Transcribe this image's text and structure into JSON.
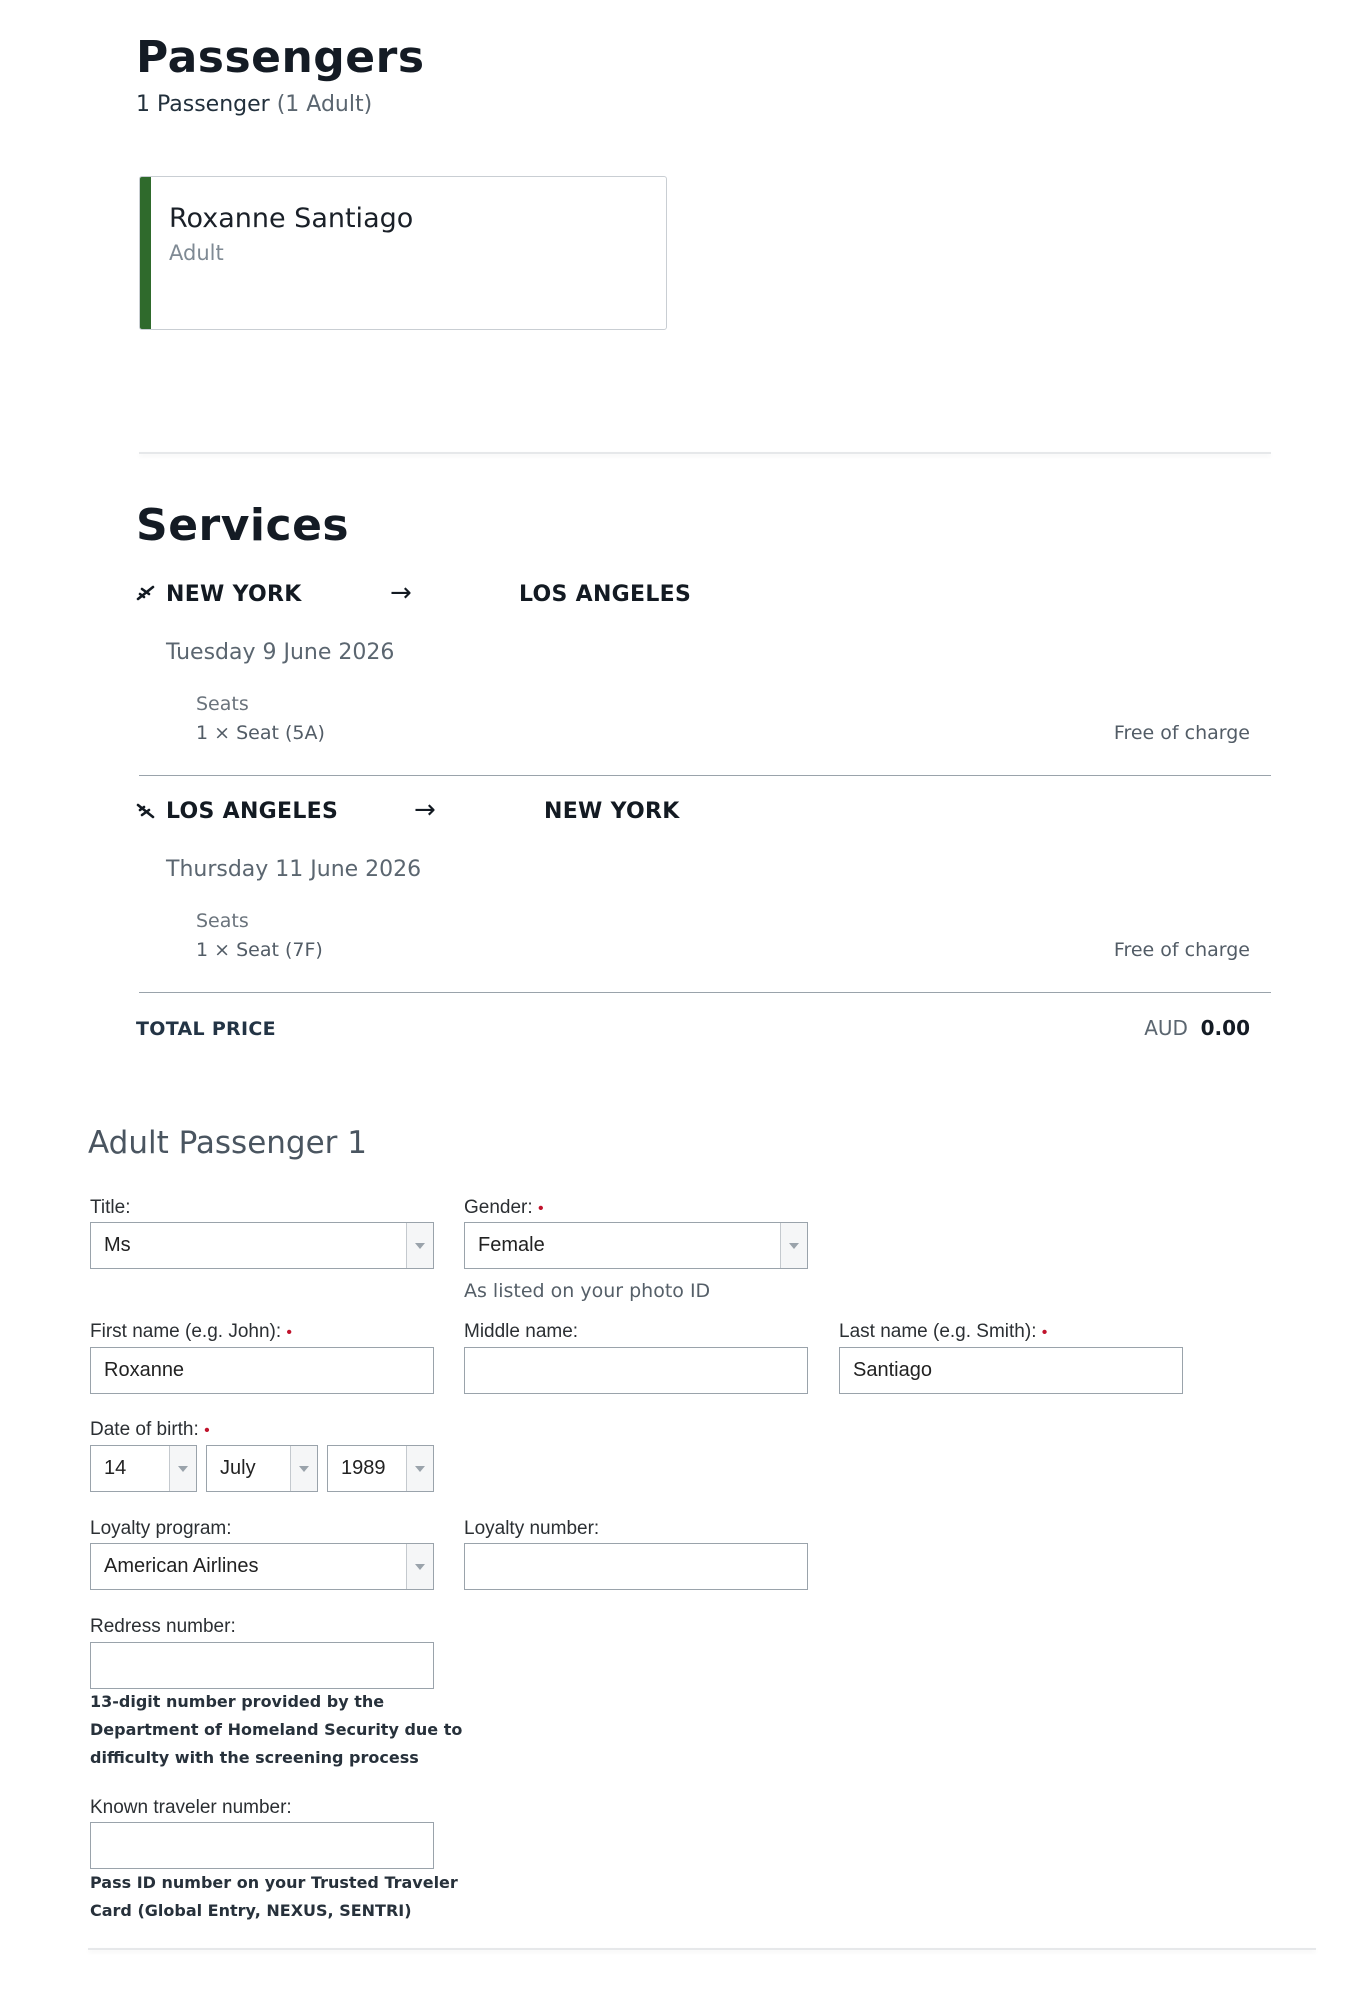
{
  "passengers": {
    "title": "Passengers",
    "count_text": "1 Passenger",
    "count_detail": "(1 Adult)",
    "card": {
      "name": "Roxanne Santiago",
      "type": "Adult"
    }
  },
  "services": {
    "title": "Services",
    "flights": [
      {
        "from": "NEW YORK",
        "to": "LOS ANGELES",
        "date": "Tuesday 9 June 2026",
        "seats_label": "Seats",
        "seat": "1 × Seat (5A)",
        "price": "Free of charge"
      },
      {
        "from": "LOS ANGELES",
        "to": "NEW YORK",
        "date": "Thursday 11 June 2026",
        "seats_label": "Seats",
        "seat": "1 × Seat (7F)",
        "price": "Free of charge"
      }
    ],
    "total_label": "TOTAL PRICE",
    "currency": "AUD",
    "total_value": "0.00"
  },
  "form": {
    "title": "Adult Passenger 1",
    "title_field": {
      "label": "Title:",
      "value": "Ms"
    },
    "gender": {
      "label": "Gender:",
      "value": "Female"
    },
    "photo_hint": "As listed on your photo ID",
    "first_name": {
      "label": "First name (e.g. John):",
      "value": "Roxanne"
    },
    "middle_name": {
      "label": "Middle name:",
      "value": ""
    },
    "last_name": {
      "label": "Last name (e.g. Smith):",
      "value": "Santiago"
    },
    "dob": {
      "label": "Date of birth:",
      "day": "14",
      "month": "July",
      "year": "1989"
    },
    "loyalty_program": {
      "label": "Loyalty program:",
      "value": "American Airlines"
    },
    "loyalty_number": {
      "label": "Loyalty number:",
      "value": ""
    },
    "redress": {
      "label": "Redress number:",
      "value": "",
      "note_lines": [
        "13-digit number provided by the",
        "Department of Homeland Security due to",
        "difficulty with the screening process"
      ]
    },
    "known_traveler": {
      "label": "Known traveler number:",
      "value": "",
      "note_lines": [
        "Pass ID number on your Trusted Traveler",
        "Card (Global Entry, NEXUS, SENTRI)"
      ]
    },
    "required_mark": "•"
  }
}
